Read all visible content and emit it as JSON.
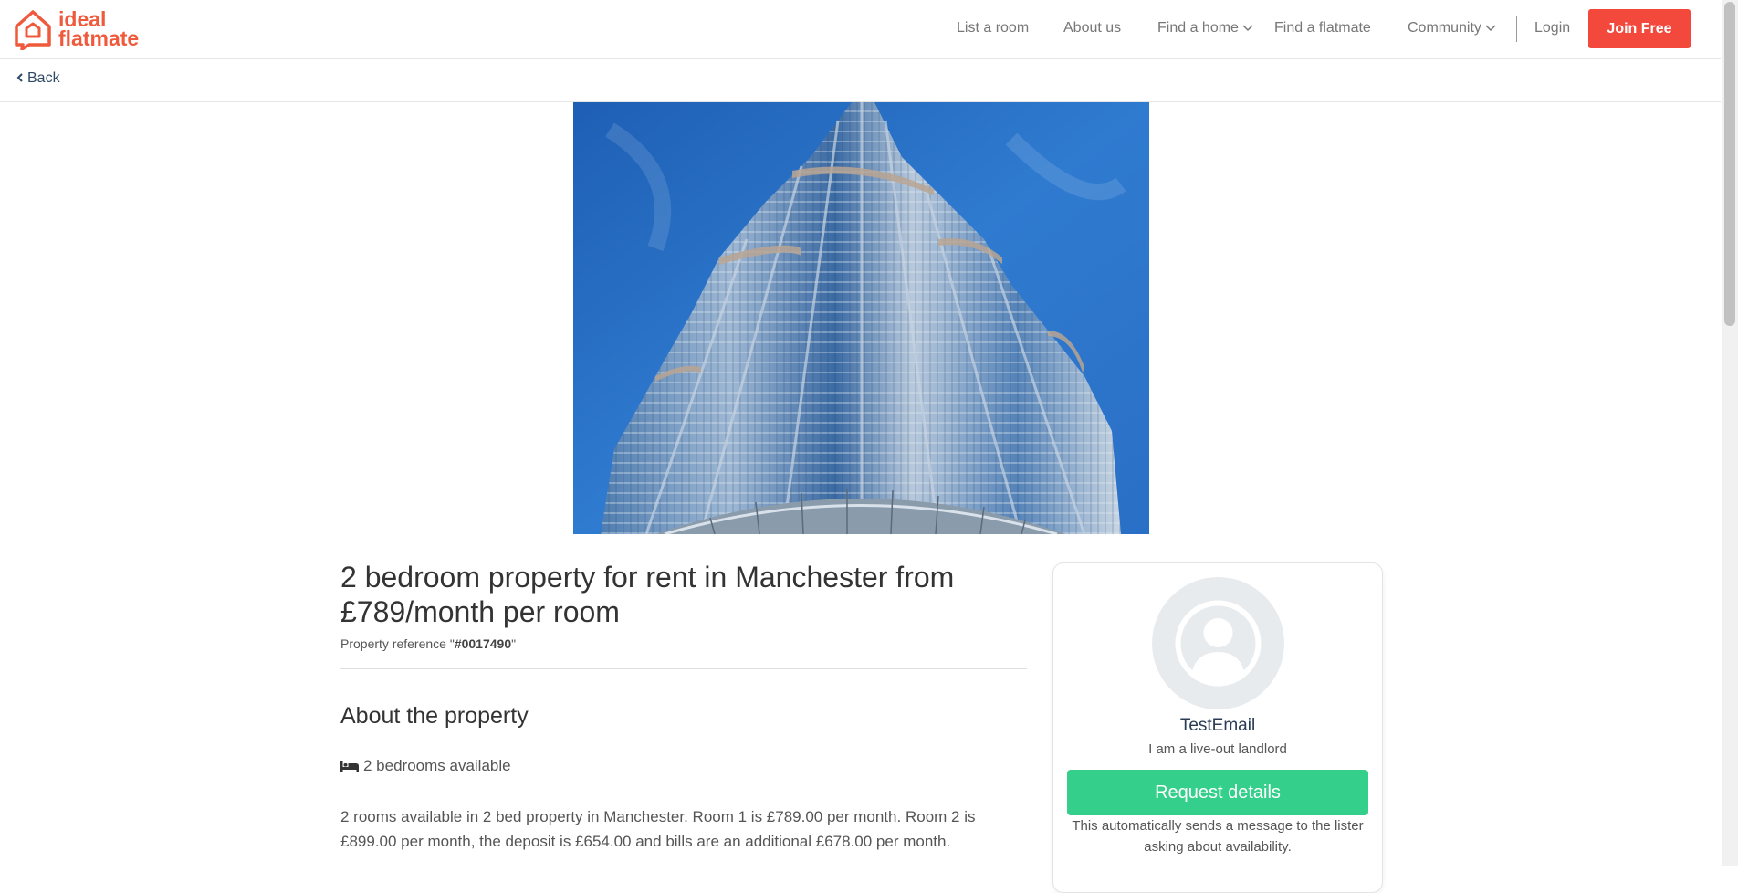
{
  "brand": {
    "line1": "ideal",
    "line2": "flatmate",
    "color": "#f05a3c"
  },
  "nav": {
    "list_room": "List a room",
    "about_us": "About us",
    "find_home": "Find a home",
    "find_flatmate": "Find a flatmate",
    "community": "Community",
    "login": "Login",
    "join": "Join Free"
  },
  "back": {
    "label": "Back"
  },
  "listing": {
    "title": "2 bedroom property for rent in Manchester from £789/month per room",
    "ref_prefix": "Property reference \"",
    "ref_value": "#0017490",
    "ref_suffix": "\"",
    "section_heading": "About the property",
    "bedrooms": "2 bedrooms available",
    "description": "2 rooms available in 2 bed property in Manchester. Room 1 is £789.00 per month. Room 2 is £899.00 per month, the deposit is £654.00 and bills are an additional £678.00 per month."
  },
  "lister": {
    "name": "TestEmail",
    "role": "I am a live-out landlord",
    "request_label": "Request details",
    "request_note": "This automatically sends a message to the lister asking about availability."
  },
  "colors": {
    "accent_red": "#f3483c",
    "request_green": "#34cf8a",
    "name_navy": "#2a3b55"
  },
  "icons": [
    "house-chat-logo-icon",
    "chevron-down-icon",
    "chevron-left-icon",
    "bed-icon",
    "user-avatar-icon"
  ]
}
